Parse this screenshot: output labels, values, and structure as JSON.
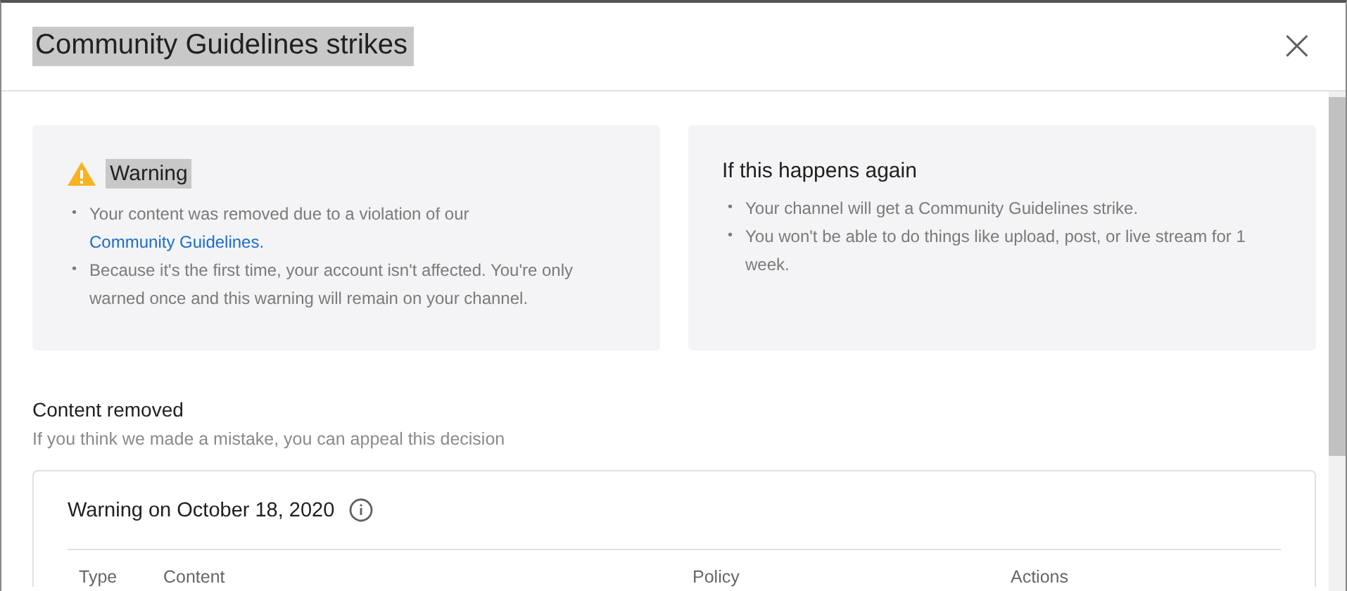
{
  "dialog": {
    "title": "Community Guidelines strikes",
    "close": "×"
  },
  "warning_card": {
    "title": "Warning",
    "bullets": [
      {
        "marker": "•",
        "text": "Your content was removed due to a violation of our ",
        "link": "Community Guidelines",
        "after": "."
      },
      {
        "marker": "•",
        "text": "Because it's the first time, your account isn't affected. You're only warned once and this warning will remain on your channel."
      }
    ]
  },
  "again_card": {
    "title": "If this happens again",
    "bullets": [
      {
        "marker": "•",
        "text": "Your channel will get a Community Guidelines strike."
      },
      {
        "marker": "•",
        "text": "You won't be able to do things like upload, post, or live stream for 1 week."
      }
    ]
  },
  "content_removed": {
    "title": "Content removed",
    "subtitle": "If you think we made a mistake, you can appeal this decision"
  },
  "strike_card": {
    "title": "Warning on October 18, 2020",
    "columns": [
      "Type",
      "Content",
      "Policy",
      "Actions"
    ]
  }
}
